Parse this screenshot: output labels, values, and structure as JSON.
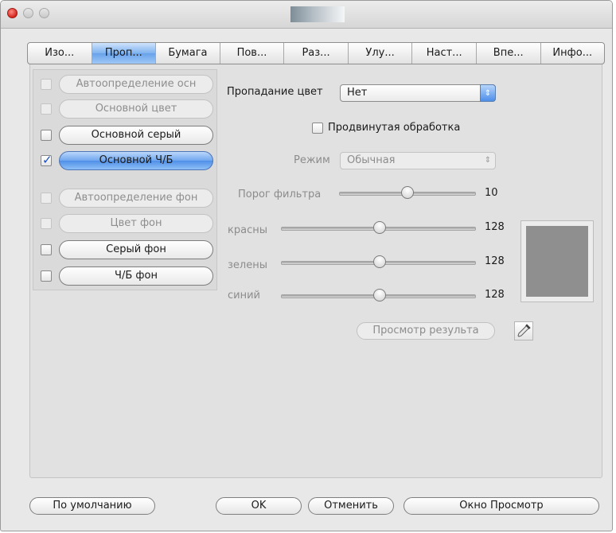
{
  "tabs": [
    "Изо...",
    "Проп...",
    "Бумага",
    "Пов...",
    "Раз...",
    "Улу...",
    "Наст...",
    "Впе...",
    "Инфо..."
  ],
  "selected_tab": 1,
  "options": [
    {
      "label": "Автоопределение осн",
      "checked": false,
      "enabled": false
    },
    {
      "label": "Основной цвет",
      "checked": false,
      "enabled": false
    },
    {
      "label": "Основной серый",
      "checked": false,
      "enabled": true
    },
    {
      "label": "Основной Ч/Б",
      "checked": true,
      "enabled": true,
      "selected": true
    },
    {
      "label": "Автоопределение фон",
      "checked": false,
      "enabled": false
    },
    {
      "label": "Цвет фон",
      "checked": false,
      "enabled": false
    },
    {
      "label": "Серый фон",
      "checked": false,
      "enabled": true
    },
    {
      "label": "Ч/Б фон",
      "checked": false,
      "enabled": true
    }
  ],
  "dropout": {
    "label": "Пропадание цвет",
    "value": "Нет"
  },
  "advanced": {
    "label": "Продвинутая обработка",
    "checked": false
  },
  "mode": {
    "label": "Режим",
    "value": "Обычная"
  },
  "filter": {
    "label": "Порог фильтра",
    "value": "10"
  },
  "red": {
    "label": "красны",
    "value": "128"
  },
  "green": {
    "label": "зелены",
    "value": "128"
  },
  "blue": {
    "label": "синий",
    "value": "128"
  },
  "preview_color": "#8f8f8f",
  "preview_result_label": "Просмотр результа",
  "buttons": {
    "defaults": "По умолчанию",
    "ok": "OK",
    "cancel": "Отменить",
    "preview_window": "Окно Просмотр"
  },
  "icons": {
    "eyedropper": "eyedropper-icon"
  }
}
